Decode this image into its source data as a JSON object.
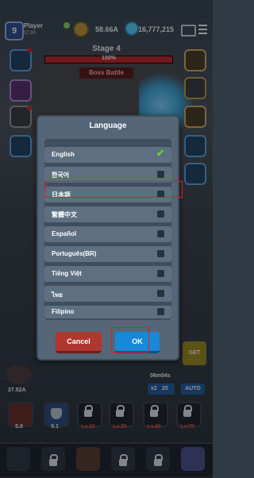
{
  "top_bar": {
    "level": "9",
    "player_name": "Player",
    "player_exp": "37.90",
    "gold": "58.66A",
    "gems": "16,777,215"
  },
  "stage": {
    "title": "Stage 4",
    "progress": 1.0,
    "progress_label": "100%",
    "boss_label": "Boss Battle"
  },
  "dialog": {
    "title": "Language",
    "languages": [
      {
        "label": "English",
        "selected": true
      },
      {
        "label": "한국어",
        "selected": false
      },
      {
        "label": "日本語",
        "selected": false
      },
      {
        "label": "繁體中文",
        "selected": false
      },
      {
        "label": "Español",
        "selected": false
      },
      {
        "label": "Português(BR)",
        "selected": false
      },
      {
        "label": "Tiếng Việt",
        "selected": false
      },
      {
        "label": "ไทย",
        "selected": false
      },
      {
        "label": "Filipino",
        "selected": false
      }
    ],
    "cancel_label": "Cancel",
    "ok_label": "OK"
  },
  "hud": {
    "power_value": "27.52A",
    "timer": "06m04s",
    "speed_label": "x2",
    "speed_minutes": "20",
    "auto_label": "AUTO",
    "get_label": "GET"
  },
  "skills": [
    {
      "label": "5.0"
    },
    {
      "label": "9.1"
    },
    {
      "label": "Lv.10"
    },
    {
      "label": "Lv.20"
    },
    {
      "label": "Lv.40"
    },
    {
      "label": "Lv.70"
    }
  ],
  "colors": {
    "accent_red": "#e0201c",
    "ok_blue": "#1889d8",
    "cancel_red": "#b0372f",
    "check_green": "#62dc27"
  },
  "icons": [
    "gear-icon",
    "gold-coin-icon",
    "gem-icon",
    "mail-icon",
    "menu-icon",
    "sword-icon",
    "lock-icon",
    "shield-icon",
    "check-icon"
  ]
}
